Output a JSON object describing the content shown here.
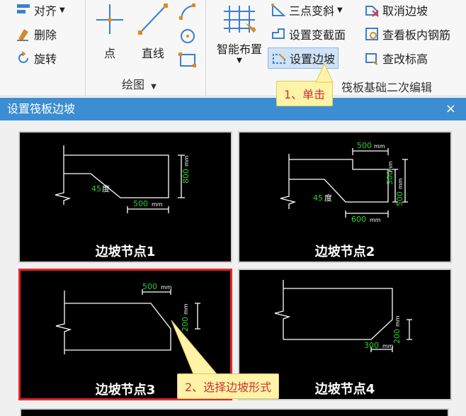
{
  "ribbon": {
    "align": "对齐",
    "delete": "删除",
    "rotate": "旋转",
    "point": "点",
    "line": "直线",
    "draw_group": "绘图",
    "smart_layout": "智能布置",
    "three_point_slope": "三点变斜",
    "set_section": "设置变截面",
    "set_slope": "设置边坡",
    "cancel_slope": "取消边坡",
    "view_rebar": "查看板内钢筋",
    "change_elevation": "查改标高",
    "raft_group": "筏板基础二次编辑"
  },
  "callouts": {
    "step1": "1、单击",
    "step2": "2、选择边坡形式"
  },
  "dialog": {
    "title": "设置筏板边坡",
    "close": "×",
    "nodes": [
      {
        "label": "边坡节点1",
        "dims": [
          "800",
          "mm",
          "45",
          "度",
          "500",
          "mm"
        ]
      },
      {
        "label": "边坡节点2",
        "dims": [
          "500",
          "mm",
          "300",
          "mm",
          "500",
          "mm",
          "45",
          "度",
          "600",
          "mm"
        ]
      },
      {
        "label": "边坡节点3",
        "dims": [
          "500",
          "mm",
          "200",
          "mm"
        ]
      },
      {
        "label": "边坡节点4",
        "dims": [
          "200",
          "mm",
          "300",
          "mm"
        ]
      }
    ]
  },
  "colors": {
    "title_bar": "#3c8dd2",
    "dim_green": "#2bd12b",
    "selected_border": "#e4262b",
    "callout_bg": "#fff3a8"
  }
}
